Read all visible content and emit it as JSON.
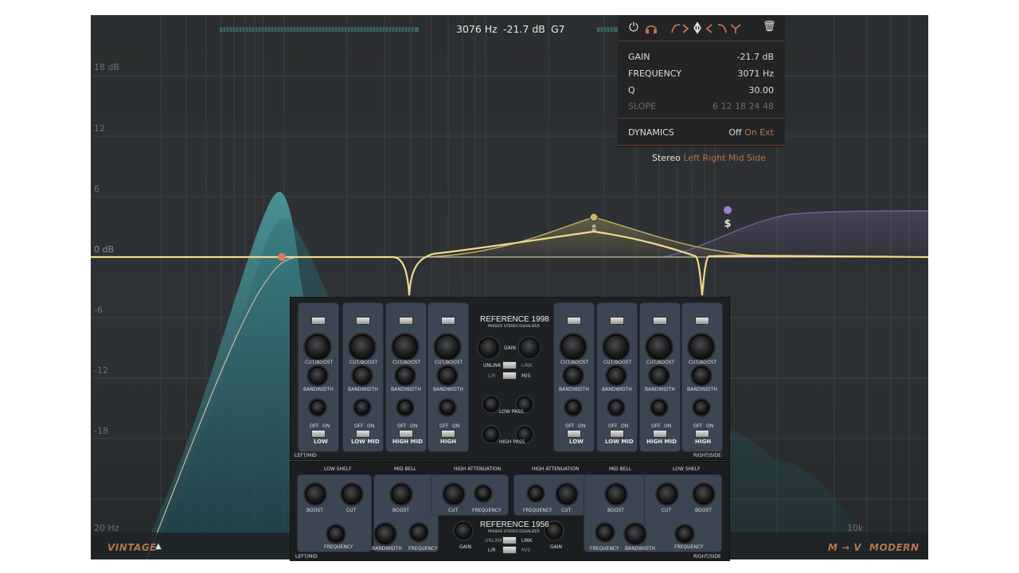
{
  "readout": {
    "frequency": "3076 Hz",
    "gain": "-21.7 dB",
    "note": "G7"
  },
  "db_scale": [
    "18 dB",
    "12",
    "6",
    "0 dB",
    "-6",
    "-12",
    "-18"
  ],
  "freq_scale": {
    "low": "20 Hz",
    "high": "10k"
  },
  "toolbar": {
    "icons": [
      "power-icon",
      "headphones-icon",
      "low-cut-icon",
      "bell-icon",
      "notch-icon",
      "high-shelf-icon",
      "high-cut-icon",
      "tilt-icon",
      "trash-icon"
    ],
    "power_glyph": "⏻",
    "trash_glyph": "🗑"
  },
  "band_panel": {
    "gain_label": "GAIN",
    "gain_value": "-21.7 dB",
    "frequency_label": "FREQUENCY",
    "frequency_value": "3071 Hz",
    "q_label": "Q",
    "q_value": "30.00",
    "slope_label": "SLOPE",
    "slope_options": [
      "6",
      "12",
      "18",
      "24",
      "48"
    ],
    "dynamics_label": "DYNAMICS",
    "dynamics_options": [
      "Off",
      "On",
      "Ext"
    ],
    "stereo_options": [
      "Stereo",
      "Left",
      "Right",
      "Mid",
      "Side"
    ]
  },
  "bottom_bar": {
    "vintage_label": "VINTAGE",
    "vintage_arrow": "▲",
    "mv_label": "M → V",
    "modern_label": "MODERN"
  },
  "ref1998": {
    "title": "REFERENCE 1998",
    "subtitle": "PASSIVE STEREO EQUALIZER",
    "gain_label": "GAIN",
    "unlink": "UNLINK",
    "link": "LINK",
    "lr": "L/R",
    "ms": "M/S",
    "low_pass": "LOW PASS",
    "high_pass": "HIGH PASS",
    "off": "OFF",
    "left_mid": "LEFT/MID",
    "right_side": "RIGHT/SIDE",
    "cut_boost": "CUT/BOOST",
    "bandwidth": "BANDWIDTH",
    "on": "ON",
    "bands": [
      "LOW",
      "LOW MID",
      "HIGH MID",
      "HIGH"
    ]
  },
  "ref1956": {
    "title": "REFERENCE 1956",
    "subtitle": "PASSIVE STEREO EQUALIZER",
    "sections": [
      "LOW SHELF",
      "MID BELL",
      "HIGH ATTENUATION",
      "HIGH ATTENUATION",
      "MID BELL",
      "LOW SHELF"
    ],
    "boost": "BOOST",
    "cut": "CUT",
    "frequency": "FREQUENCY",
    "bandwidth": "BANDWIDTH",
    "gain": "GAIN",
    "unlink": "UNLINK",
    "link": "LINK",
    "lr": "L/R",
    "ms": "M/S",
    "left_mid": "LEFT/MID",
    "right_side": "RIGHT/SIDE"
  },
  "colors": {
    "curve": "#f2d98c",
    "band1": "#e07a5f",
    "band2": "#c8b56a",
    "band3": "#9b7fd0",
    "spectrum": "#3e8f96",
    "accent": "#b9714e"
  }
}
